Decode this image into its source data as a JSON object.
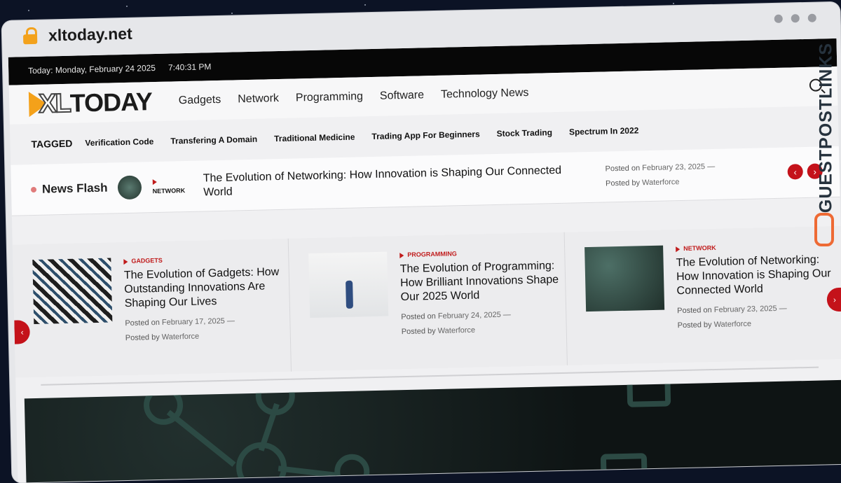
{
  "browser": {
    "url": "xltoday.net"
  },
  "topbar": {
    "date": "Today: Monday, February 24 2025",
    "time": "7:40:31 PM"
  },
  "header": {
    "logo_xl": "XL",
    "logo_today": "TODAY",
    "nav": [
      "Gadgets",
      "Network",
      "Programming",
      "Software",
      "Technology News"
    ]
  },
  "tags": {
    "label": "TAGGED",
    "items": [
      "Verification Code",
      "Transfering A Domain",
      "Traditional Medicine",
      "Trading App For Beginners",
      "Stock Trading",
      "Spectrum In 2022"
    ]
  },
  "newsflash": {
    "label": "News Flash",
    "category": "NETWORK",
    "headline": "The Evolution of Networking: How Innovation is Shaping Our Connected World",
    "posted_on_label": "Posted on",
    "date": "February 23, 2025",
    "posted_by_label": "Posted by",
    "author": "Waterforce",
    "prev": "‹",
    "next": "›"
  },
  "cards": [
    {
      "category": "GADGETS",
      "title": "The Evolution of Gadgets: How Outstanding Innovations Are Shaping Our Lives",
      "posted_on_label": "Posted on",
      "date": "February 17, 2025",
      "posted_by_label": "Posted by",
      "author": "Waterforce"
    },
    {
      "category": "PROGRAMMING",
      "title": "The Evolution of Programming: How Brilliant Innovations Shape Our 2025 World",
      "posted_on_label": "Posted on",
      "date": "February 24, 2025",
      "posted_by_label": "Posted by",
      "author": "Waterforce"
    },
    {
      "category": "NETWORK",
      "title": "The Evolution of Networking: How Innovation is Shaping Our Connected World",
      "posted_on_label": "Posted on",
      "date": "February 23, 2025",
      "posted_by_label": "Posted by",
      "author": "Waterforce"
    }
  ],
  "watermark": {
    "text": "GUESTPOSTLINKS"
  },
  "colors": {
    "accent": "#c4121a",
    "logo": "#f4a11a",
    "topbar": "#070707"
  }
}
